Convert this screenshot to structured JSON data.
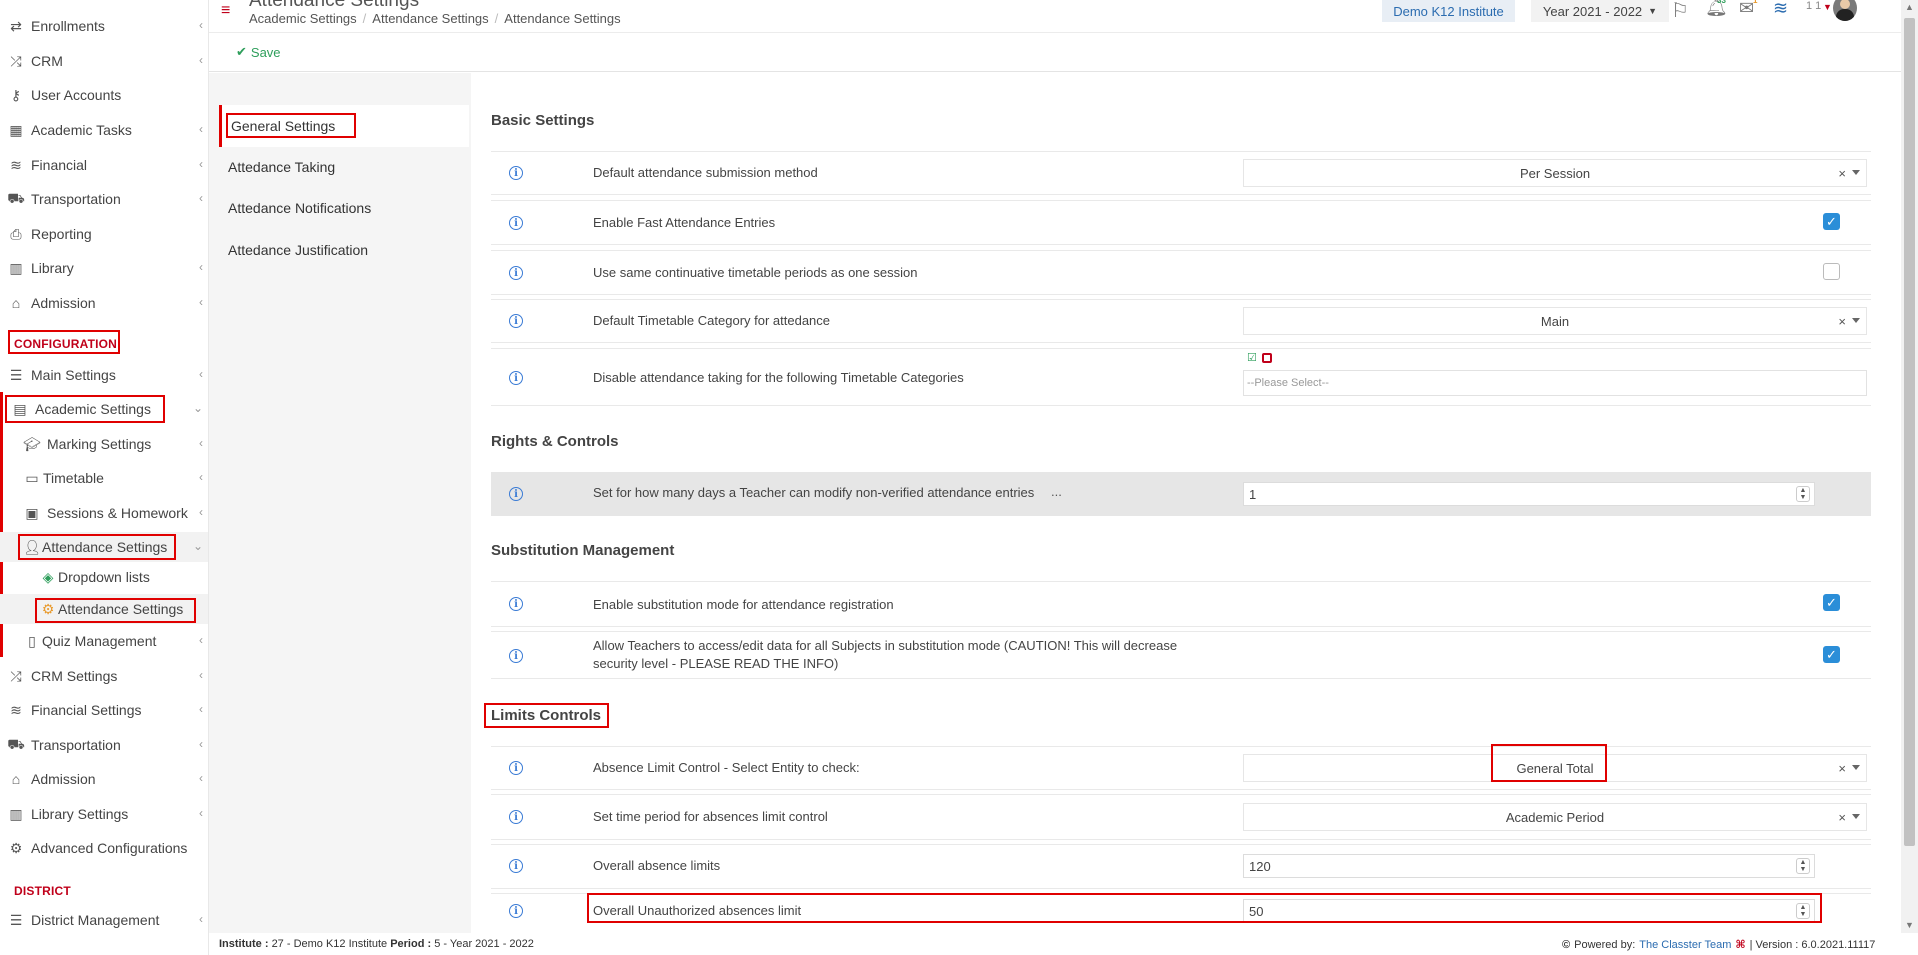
{
  "page_title": "Attendance Settings",
  "breadcrumb": [
    "Academic Settings",
    "Attendance Settings",
    "Attendance Settings"
  ],
  "header": {
    "institute": "Demo K12 Institute",
    "year": "Year 2021 - 2022",
    "user_initials": "1 1",
    "notification_count": "33",
    "message_count": "1"
  },
  "toolbar": {
    "save_label": "Save"
  },
  "sidebar": {
    "items_top": [
      {
        "label": "Enrollments",
        "icon": "enrollments-icon"
      },
      {
        "label": "CRM",
        "icon": "crm-icon"
      },
      {
        "label": "User Accounts",
        "icon": "key-icon"
      },
      {
        "label": "Academic Tasks",
        "icon": "grid-icon"
      },
      {
        "label": "Financial",
        "icon": "coins-icon"
      },
      {
        "label": "Transportation",
        "icon": "bus-icon"
      },
      {
        "label": "Reporting",
        "icon": "printer-icon"
      },
      {
        "label": "Library",
        "icon": "books-icon"
      },
      {
        "label": "Admission",
        "icon": "institution-icon"
      }
    ],
    "config_title": "CONFIGURATION",
    "config_items": [
      {
        "label": "Main Settings",
        "icon": "sliders-icon"
      },
      {
        "label": "Academic Settings",
        "icon": "classroom-icon"
      },
      {
        "label": "Marking Settings",
        "icon": "graduation-cap-icon"
      },
      {
        "label": "Timetable",
        "icon": "calendar-icon"
      },
      {
        "label": "Sessions & Homework",
        "icon": "teacher-board-icon"
      },
      {
        "label": "Attendance Settings",
        "icon": "user-check-icon"
      },
      {
        "label": "Dropdown lists",
        "icon": "layers-icon"
      },
      {
        "label": "Attendance Settings",
        "icon": "gear-icon"
      },
      {
        "label": "Quiz Management",
        "icon": "quiz-icon"
      },
      {
        "label": "CRM Settings",
        "icon": "crm-icon"
      },
      {
        "label": "Financial Settings",
        "icon": "coins-icon"
      },
      {
        "label": "Transportation",
        "icon": "bus-icon"
      },
      {
        "label": "Admission",
        "icon": "institution-icon"
      },
      {
        "label": "Library Settings",
        "icon": "books-icon"
      },
      {
        "label": "Advanced Configurations",
        "icon": "gears-icon"
      }
    ],
    "district_title": "DISTRICT",
    "district_items": [
      {
        "label": "District Management",
        "icon": "list-icon"
      }
    ]
  },
  "tabs": [
    "General Settings",
    "Attedance Taking",
    "Attedance Notifications",
    "Attedance Justification"
  ],
  "sections": {
    "basic": "Basic Settings",
    "rights": "Rights & Controls",
    "substitution": "Substitution Management",
    "limits": "Limits Controls"
  },
  "settings": {
    "submission_method": {
      "label": "Default attendance submission method",
      "value": "Per Session"
    },
    "fast_entries": {
      "label": "Enable Fast Attendance Entries",
      "checked": true
    },
    "continuative": {
      "label": "Use same continuative timetable periods as one session",
      "checked": false
    },
    "timetable_category": {
      "label": "Default Timetable Category for attedance",
      "value": "Main"
    },
    "disable_categories": {
      "label": "Disable attendance taking for the following Timetable Categories",
      "placeholder": "--Please Select--"
    },
    "modify_days": {
      "label": "Set for how many days a Teacher can modify non-verified attendance entries",
      "ellipsis": "...",
      "value": "1"
    },
    "substitution_mode": {
      "label": "Enable substitution mode for attendance registration",
      "checked": true
    },
    "teachers_access": {
      "label_line1": "Allow Teachers to access/edit data for all Subjects in substitution mode (CAUTION! This will decrease",
      "label_line2": "security level - PLEASE READ THE INFO)",
      "checked": true
    },
    "absence_entity": {
      "label": "Absence Limit Control - Select Entity to check:",
      "value": "General Total"
    },
    "time_period": {
      "label": "Set time period for absences limit control",
      "value": "Academic Period"
    },
    "overall_limits": {
      "label": "Overall absence limits",
      "value": "120"
    },
    "unauthorized_limit": {
      "label": "Overall Unauthorized absences limit",
      "value": "50"
    }
  },
  "footer": {
    "institute_label": "Institute :",
    "institute_value": "27 - Demo K12 Institute",
    "period_label": "Period :",
    "period_value": "5 - Year 2021 - 2022",
    "powered_label": "Powered by:",
    "powered_team": "The Classter Team",
    "version": "| Version : 6.0.2021.11117"
  },
  "colors": {
    "accent_red": "#e00000",
    "link_blue": "#2b6cb0",
    "checkbox_blue": "#2b8ed8",
    "save_green": "#2e9e5b"
  }
}
